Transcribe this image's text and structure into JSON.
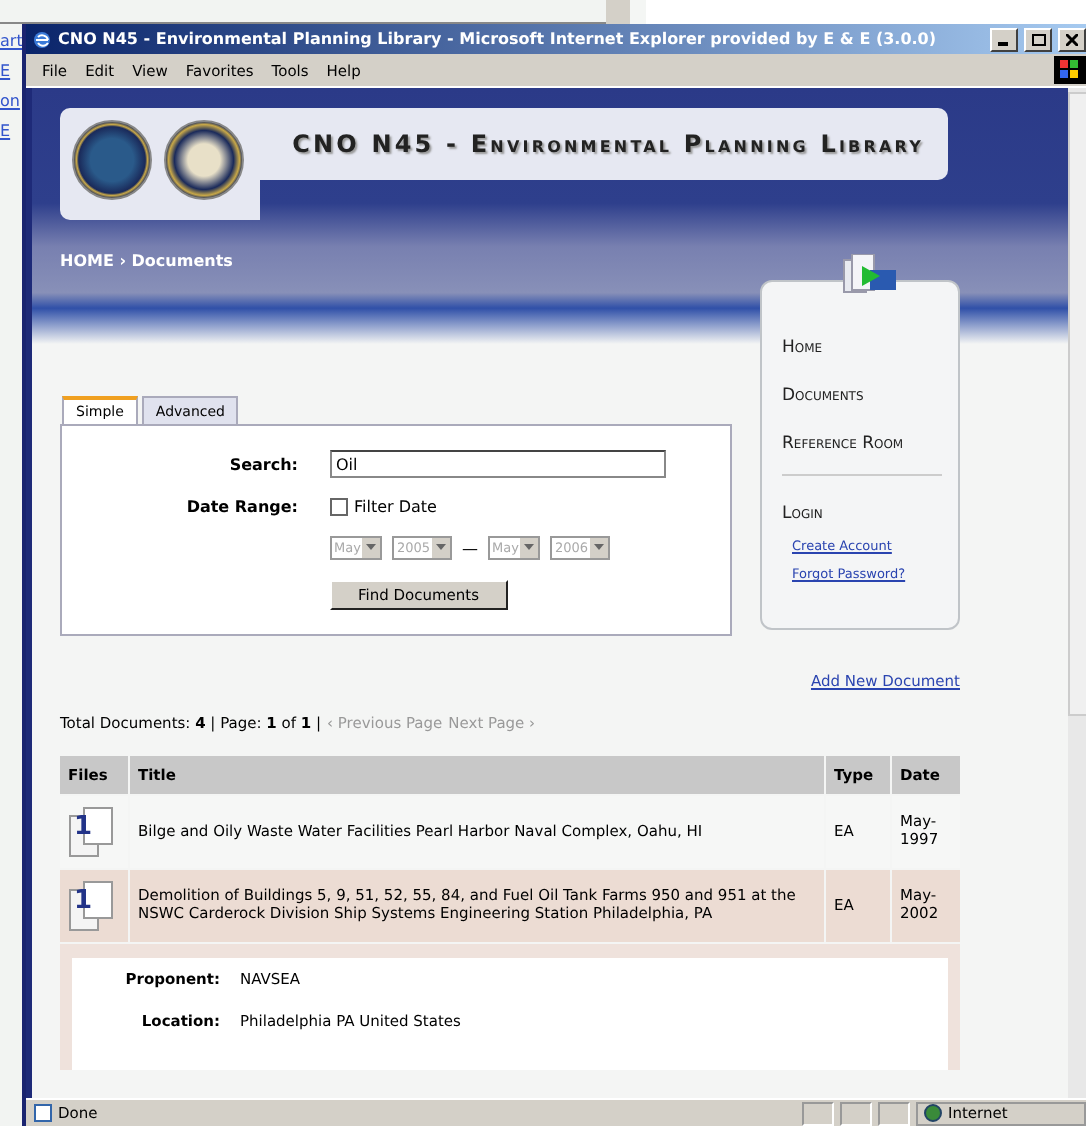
{
  "background_window": {
    "texts": [
      "art",
      "E",
      "on",
      "E"
    ]
  },
  "window": {
    "title": "CNO N45 - Environmental Planning Library - Microsoft Internet Explorer provided by E & E (3.0.0)"
  },
  "menu": [
    "File",
    "Edit",
    "View",
    "Favorites",
    "Tools",
    "Help"
  ],
  "site": {
    "title": "CNO N45 - Environmental Planning Library",
    "breadcrumb": "HOME › Documents"
  },
  "nav": {
    "items": [
      "Home",
      "Documents",
      "Reference Room"
    ],
    "login": "Login",
    "links": [
      "Create Account",
      "Forgot Password?"
    ]
  },
  "search": {
    "tabs": [
      {
        "label": "Simple",
        "selected": true
      },
      {
        "label": "Advanced",
        "selected": false
      }
    ],
    "search_label": "Search:",
    "value": "Oil",
    "date_label": "Date Range:",
    "filter": {
      "label": "Filter Date",
      "checked": false
    },
    "dates_disabled": true,
    "from_month": "May",
    "from_year": "2005",
    "dash": "—",
    "to_month": "May",
    "to_year": "2006",
    "button": "Find Documents"
  },
  "add_link": "Add New Document",
  "summary": {
    "text": "Total Documents: **4** | Page: **1** of **1** |",
    "prev": "‹ Previous Page",
    "next": "Next Page ›",
    "pager_disabled": true
  },
  "table": {
    "columns": [
      "Files",
      "Title",
      "Type",
      "Date"
    ],
    "rows": [
      {
        "files": "1",
        "title": "Bilge and Oily Waste Water Facilities Pearl Harbor Naval Complex, Oahu, HI",
        "type": "EA",
        "date": "May-1997",
        "selected": false
      },
      {
        "files": "1",
        "title": "Demolition of Buildings 5, 9, 51, 52, 55, 84, and Fuel Oil Tank Farms 950 and 951 at the NSWC Carderock Division Ship Systems Engineering Station Philadelphia, PA",
        "type": "EA",
        "date": "May-2002",
        "selected": true,
        "details": [
          {
            "label": "Proponent:",
            "value": "NAVSEA"
          },
          {
            "label": "Location:",
            "value": "Philadelphia PA United States"
          }
        ]
      }
    ]
  },
  "status_bar": {
    "text": "Done",
    "zone": "Internet"
  }
}
